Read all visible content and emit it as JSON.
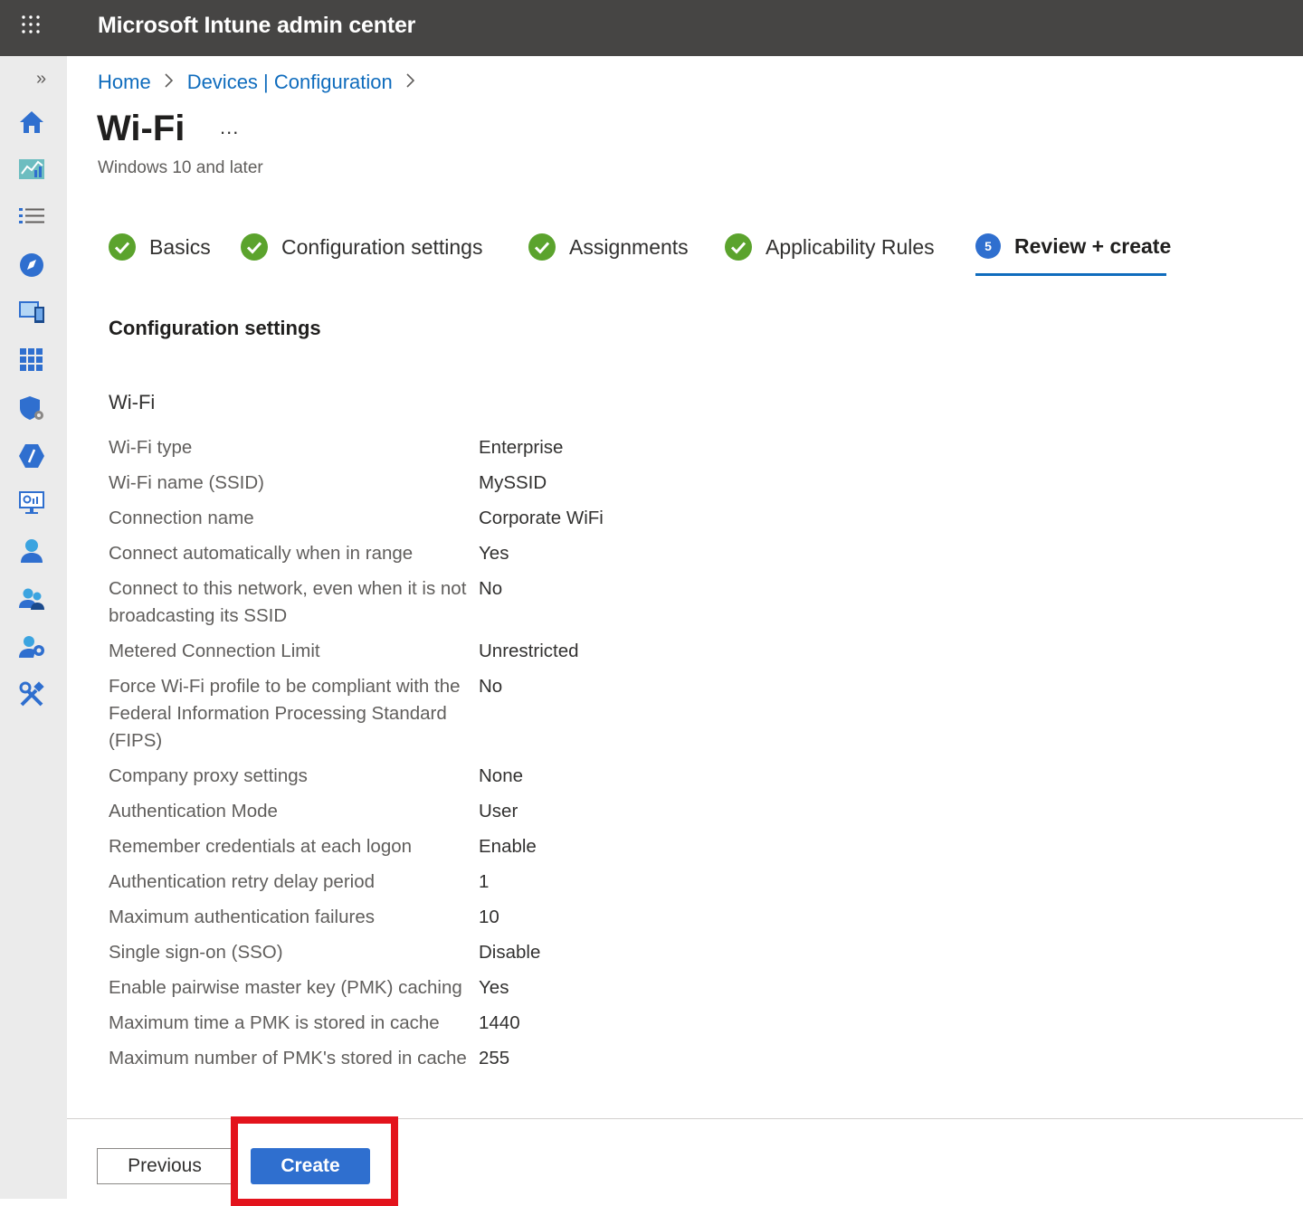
{
  "app": {
    "title": "Microsoft Intune admin center"
  },
  "breadcrumb": [
    "Home",
    "Devices | Configuration"
  ],
  "page": {
    "title": "Wi-Fi",
    "more": "...",
    "subtitle": "Windows 10 and later"
  },
  "steps": [
    {
      "label": "Basics",
      "state": "done"
    },
    {
      "label": "Configuration settings",
      "state": "done"
    },
    {
      "label": "Assignments",
      "state": "done"
    },
    {
      "label": "Applicability Rules",
      "state": "done"
    },
    {
      "label": "Review + create",
      "state": "active",
      "number": "5"
    }
  ],
  "section": {
    "title": "Configuration settings",
    "group": "Wi-Fi"
  },
  "settings": [
    {
      "key": "Wi-Fi type",
      "value": "Enterprise"
    },
    {
      "key": "Wi-Fi name (SSID)",
      "value": "MySSID"
    },
    {
      "key": "Connection name",
      "value": "Corporate WiFi"
    },
    {
      "key": "Connect automatically when in range",
      "value": "Yes"
    },
    {
      "key": "Connect to this network, even when it is not broadcasting its SSID",
      "value": "No"
    },
    {
      "key": "Metered Connection Limit",
      "value": "Unrestricted"
    },
    {
      "key": "Force Wi-Fi profile to be compliant with the Federal Information Processing Standard (FIPS)",
      "value": "No"
    },
    {
      "key": "Company proxy settings",
      "value": "None"
    },
    {
      "key": "Authentication Mode",
      "value": "User"
    },
    {
      "key": "Remember credentials at each logon",
      "value": "Enable"
    },
    {
      "key": "Authentication retry delay period",
      "value": "1"
    },
    {
      "key": "Maximum authentication failures",
      "value": "10"
    },
    {
      "key": "Single sign-on (SSO)",
      "value": "Disable"
    },
    {
      "key": "Enable pairwise master key (PMK) caching",
      "value": "Yes"
    },
    {
      "key": "Maximum time a PMK is stored in cache",
      "value": "1440"
    },
    {
      "key": "Maximum number of PMK's stored in cache",
      "value": "255"
    }
  ],
  "footer": {
    "previous": "Previous",
    "create": "Create"
  },
  "rail": {
    "expand": "»",
    "icons": [
      "home-icon",
      "dashboard-icon",
      "all-services-icon",
      "favorites-icon",
      "devices-icon",
      "apps-icon",
      "endpoint-security-icon",
      "reports-icon",
      "monitor-icon",
      "users-icon",
      "groups-icon",
      "tenant-admin-icon",
      "troubleshooting-icon"
    ]
  },
  "colors": {
    "accent": "#0f6cbd",
    "success": "#5ba32d",
    "topbar": "#464544",
    "highlight": "#e3131c"
  }
}
